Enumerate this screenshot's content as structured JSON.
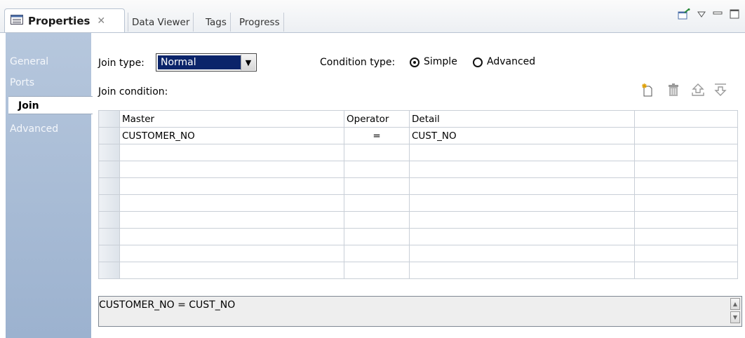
{
  "tabs": {
    "active": "Properties",
    "others": [
      "Data Viewer",
      "Tags",
      "Progress"
    ]
  },
  "sidenav": {
    "items": [
      "General",
      "Ports",
      "Join",
      "Advanced"
    ],
    "active": "Join"
  },
  "join": {
    "type_label": "Join type:",
    "type_value": "Normal",
    "condition_type_label": "Condition type:",
    "options": [
      "Simple",
      "Advanced"
    ],
    "selected_option": "Simple",
    "condition_label": "Join condition:"
  },
  "grid": {
    "columns": [
      "Master",
      "Operator",
      "Detail",
      ""
    ],
    "rows": [
      [
        "CUSTOMER_NO",
        "=",
        "CUST_NO",
        ""
      ],
      [
        "",
        "",
        "",
        ""
      ],
      [
        "",
        "",
        "",
        ""
      ],
      [
        "",
        "",
        "",
        ""
      ],
      [
        "",
        "",
        "",
        ""
      ],
      [
        "",
        "",
        "",
        ""
      ],
      [
        "",
        "",
        "",
        ""
      ],
      [
        "",
        "",
        "",
        ""
      ],
      [
        "",
        "",
        "",
        ""
      ]
    ]
  },
  "expression": "CUSTOMER_NO = CUST_NO",
  "icons": [
    "properties-icon",
    "close-icon",
    "pin-icon",
    "view-menu-icon",
    "minimize-icon",
    "maximize-icon",
    "new-icon",
    "delete-icon",
    "move-up-icon",
    "move-down-icon"
  ]
}
